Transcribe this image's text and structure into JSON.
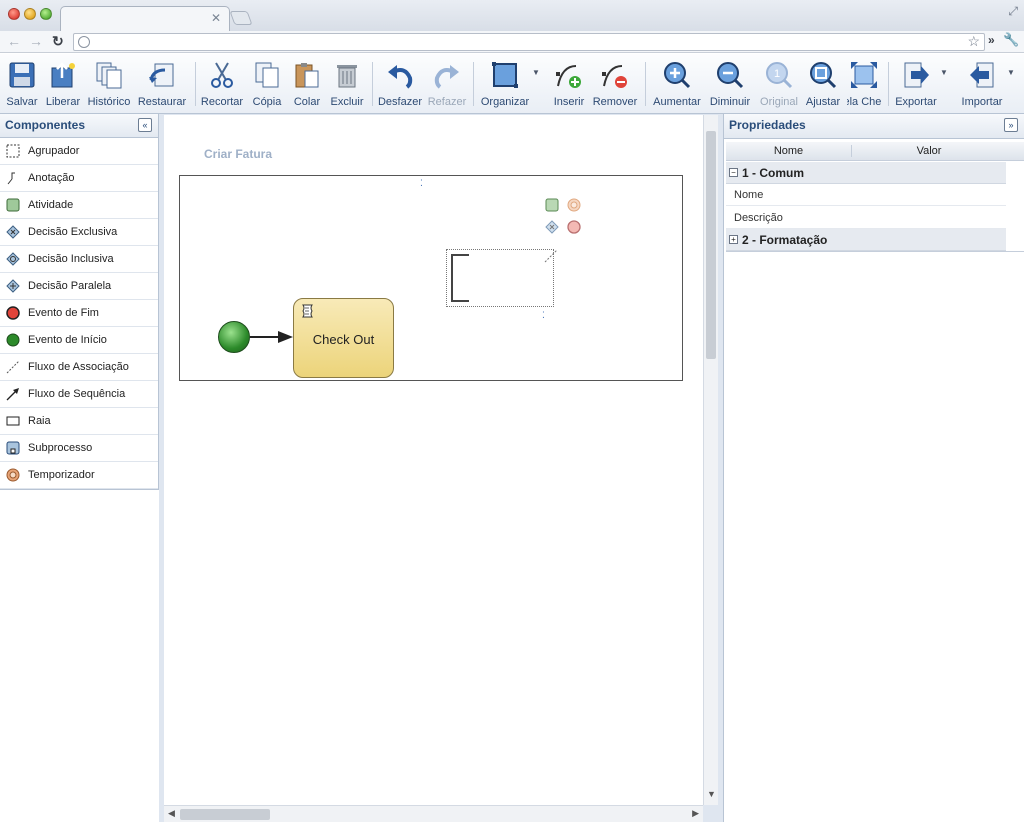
{
  "toolbar": {
    "salvar": "Salvar",
    "liberar": "Liberar",
    "historico": "Histórico",
    "restaurar": "Restaurar",
    "recortar": "Recortar",
    "copia": "Cópia",
    "colar": "Colar",
    "excluir": "Excluir",
    "desfazer": "Desfazer",
    "refazer": "Refazer",
    "organizar": "Organizar",
    "inserir": "Inserir",
    "remover": "Remover",
    "aumentar": "Aumentar",
    "diminuir": "Diminuir",
    "original": "Original",
    "ajustar": "Ajustar",
    "tela_cheia": "Tela Cheia",
    "exportar": "Exportar",
    "importar": "Importar"
  },
  "left_panel": {
    "title": "Componentes",
    "collapse": "«",
    "items": [
      {
        "label": "Agrupador",
        "icon": "group-icon"
      },
      {
        "label": "Anotação",
        "icon": "annotation-icon"
      },
      {
        "label": "Atividade",
        "icon": "activity-icon"
      },
      {
        "label": "Decisão Exclusiva",
        "icon": "exclusive-gateway-icon"
      },
      {
        "label": "Decisão Inclusiva",
        "icon": "inclusive-gateway-icon"
      },
      {
        "label": "Decisão Paralela",
        "icon": "parallel-gateway-icon"
      },
      {
        "label": "Evento de Fim",
        "icon": "end-event-icon"
      },
      {
        "label": "Evento de Início",
        "icon": "start-event-icon"
      },
      {
        "label": "Fluxo de Associação",
        "icon": "association-flow-icon"
      },
      {
        "label": "Fluxo de Sequência",
        "icon": "sequence-flow-icon"
      },
      {
        "label": "Raia",
        "icon": "lane-icon"
      },
      {
        "label": "Subprocesso",
        "icon": "subprocess-icon"
      },
      {
        "label": "Temporizador",
        "icon": "timer-icon"
      }
    ]
  },
  "canvas": {
    "diagram_title": "Criar Fatura",
    "task_label": "Check Out"
  },
  "right_panel": {
    "title": "Propriedades",
    "collapse": "»",
    "col_name": "Nome",
    "col_value": "Valor",
    "group_1": "1 - Comum",
    "group_1_toggle": "−",
    "row_nome": "Nome",
    "row_descricao": "Descrição",
    "group_2": "2 - Formatação",
    "group_2_toggle": "+"
  },
  "colors": {
    "accent": "#2a4d7a",
    "task_fill": "#ecd47a",
    "start_event": "#2c8a2a",
    "end_event": "#e0443a"
  }
}
